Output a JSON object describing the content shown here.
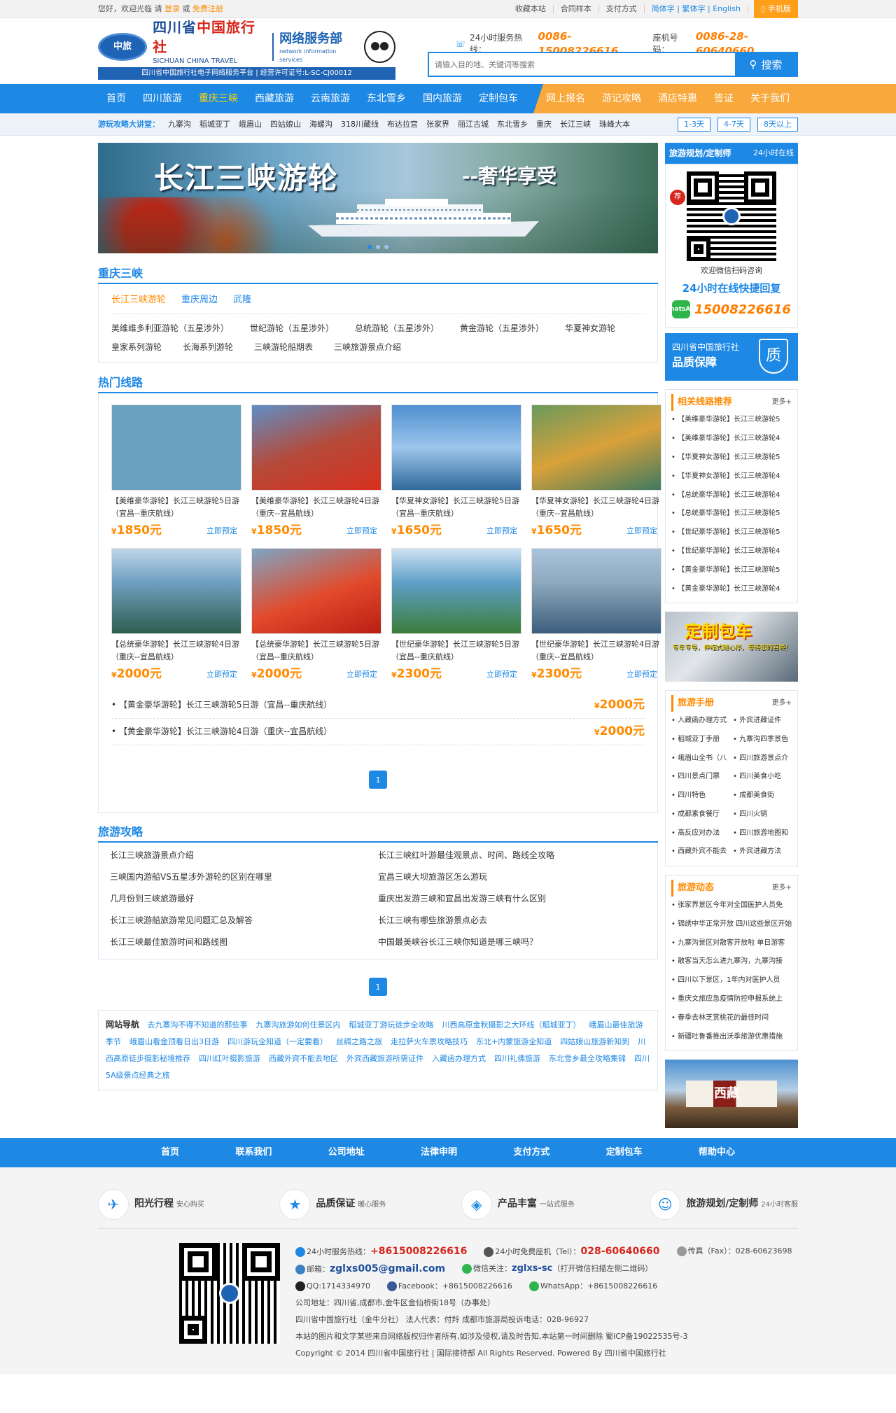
{
  "topbar": {
    "welcome": "您好，欢迎光临 请",
    "login": "登录",
    "or": "或",
    "register": "免费注册",
    "links": [
      "收藏本站",
      "合同样本",
      "支付方式"
    ],
    "lang_simplified": "简体字",
    "lang_traditional": "繁体字",
    "lang_en": "English",
    "mobile": "手机版"
  },
  "header": {
    "logo_mark": "中旅",
    "logo_cn_a": "四川省",
    "logo_cn_b": "中国旅行社",
    "logo_en": "SICHUAN CHINA TRAVEL SERVICE",
    "logo_net": "网络服务部",
    "logo_net_en": "network information services",
    "strip": "四川省中国旅行社电子网络服务平台 | 经营许可证号:L-SC-CJ00012",
    "hotline_label": "24小时服务热线：",
    "hotline": "0086-15008226616",
    "fixed_label": "座机号码：",
    "fixed": "0086-28-60640660",
    "search_placeholder": "请输入目的地、关键词等搜索",
    "search_btn": "搜索"
  },
  "nav": {
    "items": [
      "首页",
      "四川旅游",
      "重庆三峡",
      "西藏旅游",
      "云南旅游",
      "东北雪乡",
      "国内旅游",
      "定制包车"
    ],
    "right": [
      "网上报名",
      "游记攻略",
      "酒店特惠",
      "签证",
      "关于我们"
    ]
  },
  "subnav": {
    "label": "游玩攻略大讲堂：",
    "items": [
      "九寨沟",
      "稻城亚丁",
      "峨眉山",
      "四姑娘山",
      "海螺沟",
      "318川藏线",
      "布达拉宫",
      "张家界",
      "丽江古城",
      "东北雪乡",
      "重庆",
      "长江三峡",
      "珠峰大本"
    ],
    "tags": [
      "1-3天",
      "4-7天",
      "8天以上"
    ]
  },
  "banner": {
    "title": "长江三峡游轮",
    "subtitle": "--奢华享受"
  },
  "section1": {
    "title": "重庆三峡",
    "tabs": [
      "长江三峡游轮",
      "重庆周边",
      "武隆"
    ],
    "links": [
      "美维维多利亚游轮（五星涉外）",
      "世纪游轮（五星涉外）",
      "总统游轮（五星涉外）",
      "黄金游轮（五星涉外）",
      "华夏神女游轮",
      "皇家系列游轮",
      "长海系列游轮",
      "三峡游轮船期表",
      "三峡旅游景点介绍"
    ]
  },
  "hot": {
    "title": "热门线路",
    "book": "立即预定",
    "products": [
      {
        "name": "【美维豪华游轮】长江三峡游轮5日游（宜昌--重庆航线）",
        "price": "1850"
      },
      {
        "name": "【美维豪华游轮】长江三峡游轮4日游（重庆--宜昌航线）",
        "price": "1850"
      },
      {
        "name": "【华夏神女游轮】长江三峡游轮5日游（宜昌--重庆航线）",
        "price": "1650"
      },
      {
        "name": "【华夏神女游轮】长江三峡游轮4日游（重庆--宜昌航线）",
        "price": "1650"
      },
      {
        "name": "【总统豪华游轮】长江三峡游轮4日游（重庆--宜昌航线）",
        "price": "2000"
      },
      {
        "name": "【总统豪华游轮】长江三峡游轮5日游（宜昌--重庆航线）",
        "price": "2000"
      },
      {
        "name": "【世纪豪华游轮】长江三峡游轮5日游（宜昌--重庆航线）",
        "price": "2300"
      },
      {
        "name": "【世纪豪华游轮】长江三峡游轮4日游（重庆--宜昌航线）",
        "price": "2300"
      }
    ],
    "textlist": [
      {
        "name": "【黄金豪华游轮】长江三峡游轮5日游（宜昌--重庆航线）",
        "price": "2000"
      },
      {
        "name": "【黄金豪华游轮】长江三峡游轮4日游（重庆--宜昌航线）",
        "price": "2000"
      }
    ],
    "currency": "¥",
    "unit": "元",
    "page": "1"
  },
  "guide": {
    "title": "旅游攻略",
    "items": [
      "长江三峡旅游景点介绍",
      "长江三峡红叶游最佳观景点、时间、路线全攻略",
      "三峡国内游船VS五星涉外游轮的区别在哪里",
      "宜昌三峡大坝旅游区怎么游玩",
      "几月份到三峡旅游最好",
      "重庆出发游三峡和宜昌出发游三峡有什么区别",
      "长江三峡游船旅游常见问题汇总及解答",
      "长江三峡有哪些旅游景点必去",
      "长江三峡最佳旅游时间和路线图",
      "中国最美峡谷长江三峡你知道是哪三峡吗？"
    ],
    "page": "1"
  },
  "sitemap": {
    "label": "网站导航",
    "links": [
      "去九寨沟不得不知道的那些事",
      "九寨沟旅游如何住景区内",
      "稻城亚丁游玩徒步全攻略",
      "川西高原金秋摄影之大环线（稻城亚丁）",
      "峨眉山最佳旅游季节",
      "峨眉山看金顶看日出3日游",
      "四川游玩全知道（一定要看）",
      "丝绸之路之旅",
      "走拉萨火车票攻略技巧",
      "东北+内蒙旅游全知道",
      "四姑娘山旅游新知到",
      "川西高原徒步摄影秘境推荐",
      "四川红叶摄影旅游",
      "西藏外宾不能去地区",
      "外宾西藏旅游所需证件",
      "入藏函办理方式",
      "四川礼佛旅游",
      "东北雪乡最全攻略集锦",
      "四川5A级景点经典之旅"
    ]
  },
  "side": {
    "plan_title": "旅游规划/定制师",
    "plan_sub": "24小时在线",
    "recommend": "荐",
    "scan": "欢迎微信扫码咨询",
    "online": "24小时在线快捷回复",
    "phone": "15008226616",
    "wa": "WhatsApp",
    "quality_a": "四川省中国旅行社",
    "quality_b": "品质保障",
    "quality_icon": "质",
    "related_title": "相关线路推荐",
    "more": "更多+",
    "related": [
      "【美维豪华游轮】长江三峡游轮5",
      "【美维豪华游轮】长江三峡游轮4",
      "【华夏神女游轮】长江三峡游轮5",
      "【华夏神女游轮】长江三峡游轮4",
      "【总统豪华游轮】长江三峡游轮4",
      "【总统豪华游轮】长江三峡游轮5",
      "【世纪豪华游轮】长江三峡游轮5",
      "【世纪豪华游轮】长江三峡游轮4",
      "【黄金豪华游轮】长江三峡游轮5",
      "【黄金豪华游轮】长江三峡游轮4"
    ],
    "charter_title": "定制包车",
    "charter_sub": "专车专导，伸缩式随心停，等待您的召唤！",
    "manual_title": "旅游手册",
    "manual": [
      "入藏函办理方式",
      "外宾进藏证件",
      "稻城亚丁手册",
      "九寨沟四季景色",
      "峨眉山全书（八",
      "四川旅游景点介",
      "四川景点门票",
      "四川美食小吃",
      "四川特色",
      "成都美食街",
      "成都素食餐厅",
      "四川火锅",
      "高反应对办法",
      "四川旅游地图和",
      "西藏外宾不能去",
      "外宾进藏方法"
    ],
    "news_title": "旅游动态",
    "news": [
      "张家界景区今年对全国医护人员免",
      "锦绣中华正常开放 四川这些景区开始",
      "九寨沟景区对散客开放啦 单日游客",
      "散客当天怎么进九寨沟，九寨沟接",
      "四川以下景区，1年内对医护人员",
      "重庆文旅应急疫情防控申报系统上",
      "春季去林芝赏桃花的最佳时间",
      "新疆吐鲁番推出沃季旅游优惠措施"
    ],
    "tibet_text": "西藏"
  },
  "footer": {
    "nav": [
      "首页",
      "联系我们",
      "公司地址",
      "法律申明",
      "支付方式",
      "定制包车",
      "帮助中心"
    ],
    "services": [
      {
        "icon": "✈",
        "t": "阳光行程",
        "s": "安心购买"
      },
      {
        "icon": "★",
        "t": "品质保证",
        "s": "暖心服务"
      },
      {
        "icon": "◈",
        "t": "产品丰富",
        "s": "一站式服务"
      },
      {
        "icon": "☺",
        "t": "旅游规划/定制师",
        "s": "24小时客服"
      }
    ],
    "hotline_label": "24小时服务热线：",
    "hotline": "+8615008226616",
    "fixed_label": "24小时免费座机（Tel）：",
    "fixed": "028-60640660",
    "fax": "传真（Fax）：028-60623698",
    "email_label": "邮箱：",
    "email": "zglxs005@gmail.com",
    "wechat_label": "微信关注：",
    "wechat": "zglxs-sc",
    "wechat_note": "（打开微信扫描左侧二维码）",
    "qq": "QQ:1714334970",
    "facebook": "Facebook：+8615008226616",
    "whatsapp": "WhatsApp：+8615008226616",
    "address": "公司地址：四川省,成都市,金牛区金仙桥街18号（办事处）",
    "legal": "四川省中国旅行社（金牛分社） 法人代表：付羚  成都市旅游局投诉电话：028-96927",
    "copy_note": "本站的图片和文字某些来自网络版权归作者所有,如涉及侵权,请及时告知,本站第一时间删除   蜀ICP备19022535号-3",
    "copyright": "Copyright © 2014 四川省中国旅行社 | 国际接待部 All Rights Reserved. Powered By 四川省中国旅行社"
  },
  "colors": {
    "primary": "#1e88e5",
    "accent": "#ff8a00",
    "nav_orange": "#f9a83b"
  }
}
